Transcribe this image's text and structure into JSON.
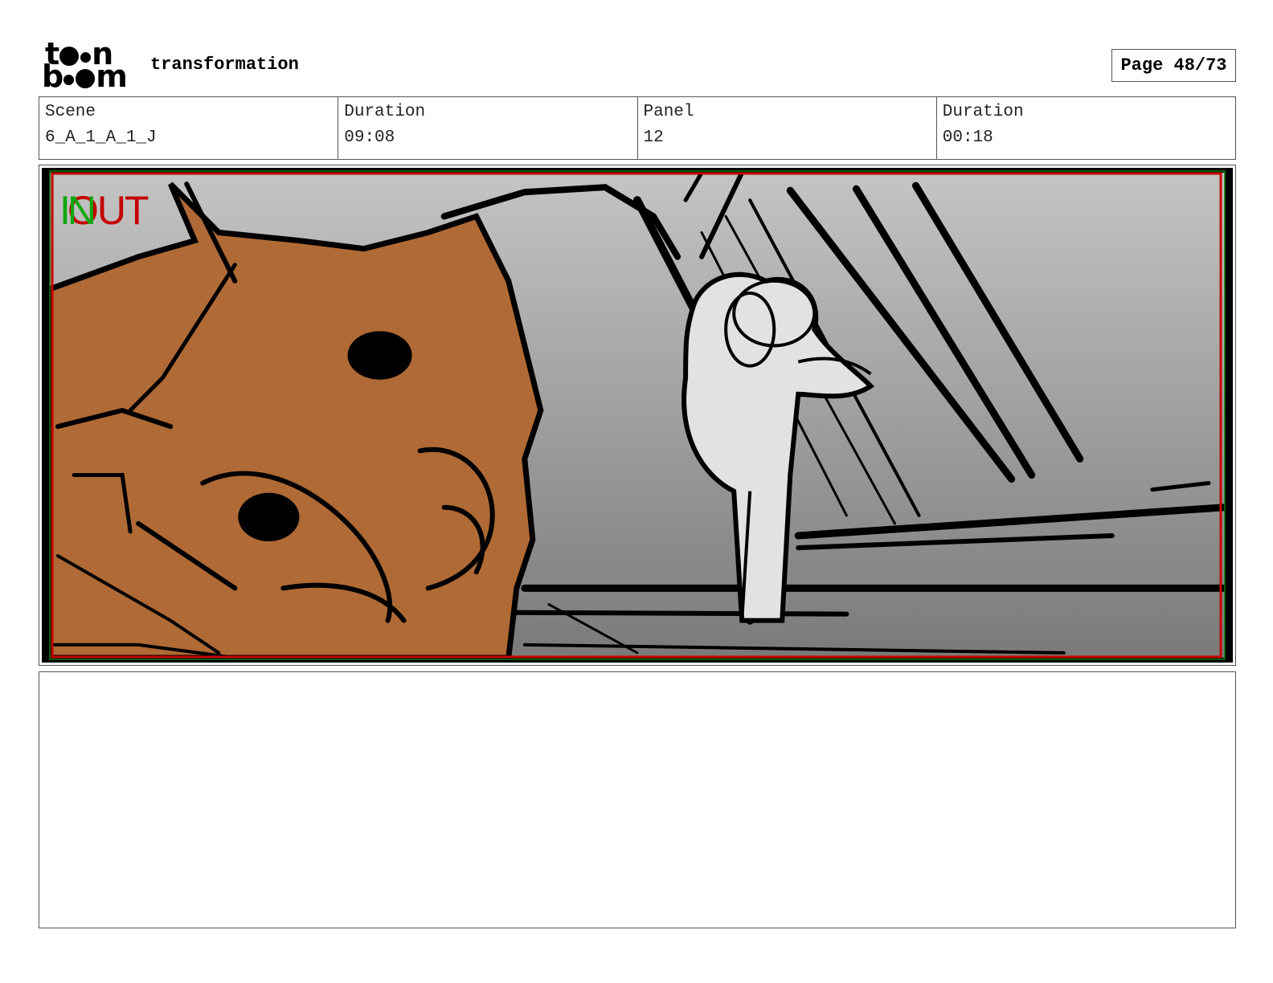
{
  "header": {
    "logo_top": "toon",
    "logo_bottom": "boom",
    "project_title": "transformation",
    "page_label": "Page 48/73"
  },
  "info": {
    "scene_label": "Scene",
    "scene_value": "6_A_1_A_1_J",
    "scene_duration_label": "Duration",
    "scene_duration_value": "09:08",
    "panel_label": "Panel",
    "panel_value": "12",
    "panel_duration_label": "Duration",
    "panel_duration_value": "00:18"
  },
  "panel": {
    "in_marker": "IN",
    "out_marker": "OUT",
    "colors": {
      "safe_frame": "#c40000",
      "in_marker": "#11a511",
      "character_fill": "#b06a35",
      "figure_fill": "#e2e2e2"
    }
  },
  "notes": {
    "text": ""
  }
}
